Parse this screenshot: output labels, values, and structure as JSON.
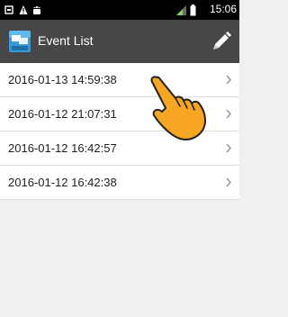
{
  "status_bar": {
    "time": "15:06",
    "icons": [
      "screenshot-icon",
      "warning-icon",
      "android-icon",
      "signal-icon",
      "battery-icon"
    ]
  },
  "app_bar": {
    "title": "Event List",
    "app_icon": "app-logo-icon",
    "action_icon": "pencil-icon"
  },
  "events": [
    {
      "label": "2016-01-13 14:59:38"
    },
    {
      "label": "2016-01-12 21:07:31"
    },
    {
      "label": "2016-01-12 16:42:57"
    },
    {
      "label": "2016-01-12 16:42:38"
    }
  ],
  "colors": {
    "status_bar": "#000000",
    "app_bar": "#474747",
    "list_bg": "#ffffff",
    "page_bg": "#f0f0f0",
    "hand": "#f6a623",
    "battery_accent": "#7fd35a"
  }
}
